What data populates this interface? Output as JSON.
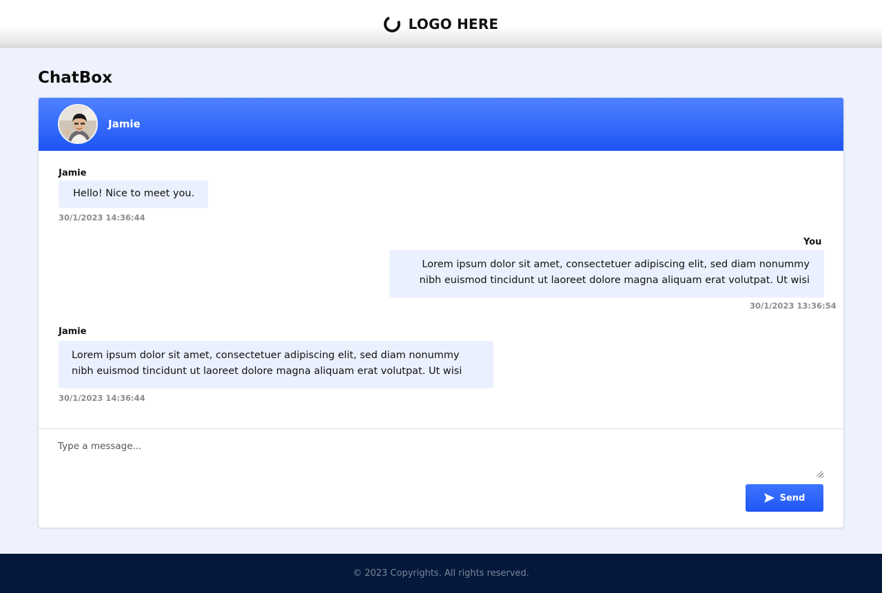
{
  "header": {
    "logo_text": "LOGO HERE",
    "logo_icon": "loading-circle-icon"
  },
  "page": {
    "title": "ChatBox"
  },
  "chat": {
    "contact_name": "Jamie",
    "messages": [
      {
        "sender": "Jamie",
        "text": "Hello! Nice to meet you.",
        "time": "30/1/2023 14:36:44"
      },
      {
        "sender": "You",
        "text_line1": "Lorem ipsum dolor sit amet, consectetuer adipiscing elit, sed diam nonummy",
        "text_line2": "nibh euismod tincidunt ut laoreet dolore magna aliquam erat volutpat. Ut wisi",
        "time": "30/1/2023 13:36:54"
      },
      {
        "sender": "Jamie",
        "text_line1": "Lorem ipsum dolor sit amet, consectetuer adipiscing elit, sed diam nonummy",
        "text_line2": "nibh euismod tincidunt ut laoreet dolore magna aliquam erat volutpat. Ut wisi",
        "time": "30/1/2023 14:36:44"
      }
    ]
  },
  "composer": {
    "placeholder": "Type a message...",
    "value": "",
    "send_label": "Send",
    "send_icon": "send-icon"
  },
  "footer": {
    "text": "© 2023 Copyrights. All rights reserved."
  },
  "colors": {
    "accent": "#1d55f5",
    "bubble": "#eaf0fd",
    "background": "#edf2fd",
    "footer": "#03183a"
  }
}
